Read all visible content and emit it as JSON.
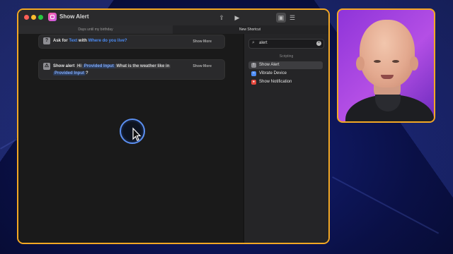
{
  "window": {
    "title": "Show Alert",
    "tabs": [
      "Days until my birthday",
      "New Shortcut"
    ]
  },
  "actions": [
    {
      "icon": "?",
      "label": "Ask for",
      "type_token": "Text",
      "with_label": "with",
      "prompt_token": "Where do you live?",
      "show_more": "Show More"
    },
    {
      "icon": "⚠",
      "label": "Show alert",
      "text_hi": "Hi",
      "var_token": "Provided Input",
      "text_rest": "What is the weather like in",
      "var_token2": "Provided Input",
      "text_end": "?",
      "show_more": "Show More"
    }
  ],
  "sidebar": {
    "search_value": "alert",
    "section": "Scripting",
    "results": [
      {
        "label": "Show Alert",
        "icon_color": "#8e8e93",
        "selected": true
      },
      {
        "label": "Vibrate Device",
        "icon_color": "#4d8df6",
        "selected": false
      },
      {
        "label": "Show Notification",
        "icon_color": "#e5483d",
        "selected": false
      }
    ]
  },
  "colors": {
    "accent_border": "#f3a823",
    "token_blue": "#4d8df6"
  }
}
